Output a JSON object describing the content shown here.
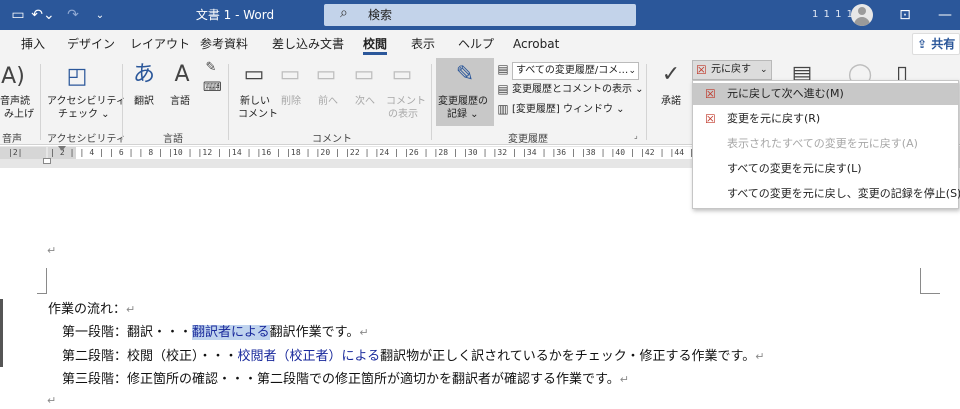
{
  "titlebar": {
    "doc_title": "文書 1 - Word",
    "search_text": "検索",
    "user_name": "1 1 1 1"
  },
  "tabs": [
    "挿入",
    "デザイン",
    "レイアウト",
    "参考資料",
    "差し込み文書",
    "校閲",
    "表示",
    "ヘルプ",
    "Acrobat"
  ],
  "active_tab": "校閲",
  "share_label": "共有",
  "ribbon": {
    "read_aloud": [
      "音声読",
      "み上げ"
    ],
    "accessibility": [
      "アクセシビリティ",
      "チェック ⌄"
    ],
    "translate": "翻訳",
    "language": "言語",
    "new_comment": [
      "新しい",
      "コメント"
    ],
    "delete": "削除",
    "previous": "前へ",
    "next": "次へ",
    "show_comments": [
      "コメント",
      "の表示"
    ],
    "track_changes": [
      "変更履歴の",
      "記録 ⌄"
    ],
    "markup_combo": "すべての変更履歴/コメ…",
    "show_markup": "変更履歴とコメントの表示 ⌄",
    "reviewing_pane": "[変更履歴] ウィンドウ ⌄",
    "accept": "承諾",
    "reject_label": "元に戻す",
    "groups": {
      "voice": "音声",
      "accessibility": "アクセシビリティ",
      "language": "言語",
      "comments": "コメント",
      "tracking": "変更履歴"
    }
  },
  "ruler": {
    "gutter": "|2|",
    "ticks": "  | 2 | | 4 | | 6 | | 8 | |10 | |12 | |14 | |16 | |18 | |20 | |22 | |24 | |26 | |28 | |30 | |32 | |34 | |36 | |38 | |40 | |42 | |44 | |46 | |48 | |50 | |52 | |54 | |56 | |58 | |60 | |62 |"
  },
  "document": {
    "para_mark": "↵",
    "line1": "作業の流れ：",
    "line2_a": "第一段階：翻訳・・・",
    "line2_ins": "翻訳者による",
    "line2_b": "翻訳作業です。",
    "line3_a": "第二段階：校閲（校正）・・・",
    "line3_ins": "校閲者（校正者）による",
    "line3_b": "翻訳物が正しく訳されているかをチェック・修正する作業です。",
    "line4": "第三段階：修正箇所の確認・・・第二段階での修正箇所が適切かを翻訳者が確認する作業です。"
  },
  "dropdown": {
    "items": [
      "元に戻して次へ進む(M)",
      "変更を元に戻す(R)",
      "表示されたすべての変更を元に戻す(A)",
      "すべての変更を元に戻す(L)",
      "すべての変更を元に戻し、変更の記録を停止(S)"
    ]
  },
  "colors": {
    "titlebar": "#2b579a",
    "ribbon_bg": "#f3f3f3",
    "insertion_text": "#1a2a9c",
    "selection": "#bfd3ee"
  }
}
